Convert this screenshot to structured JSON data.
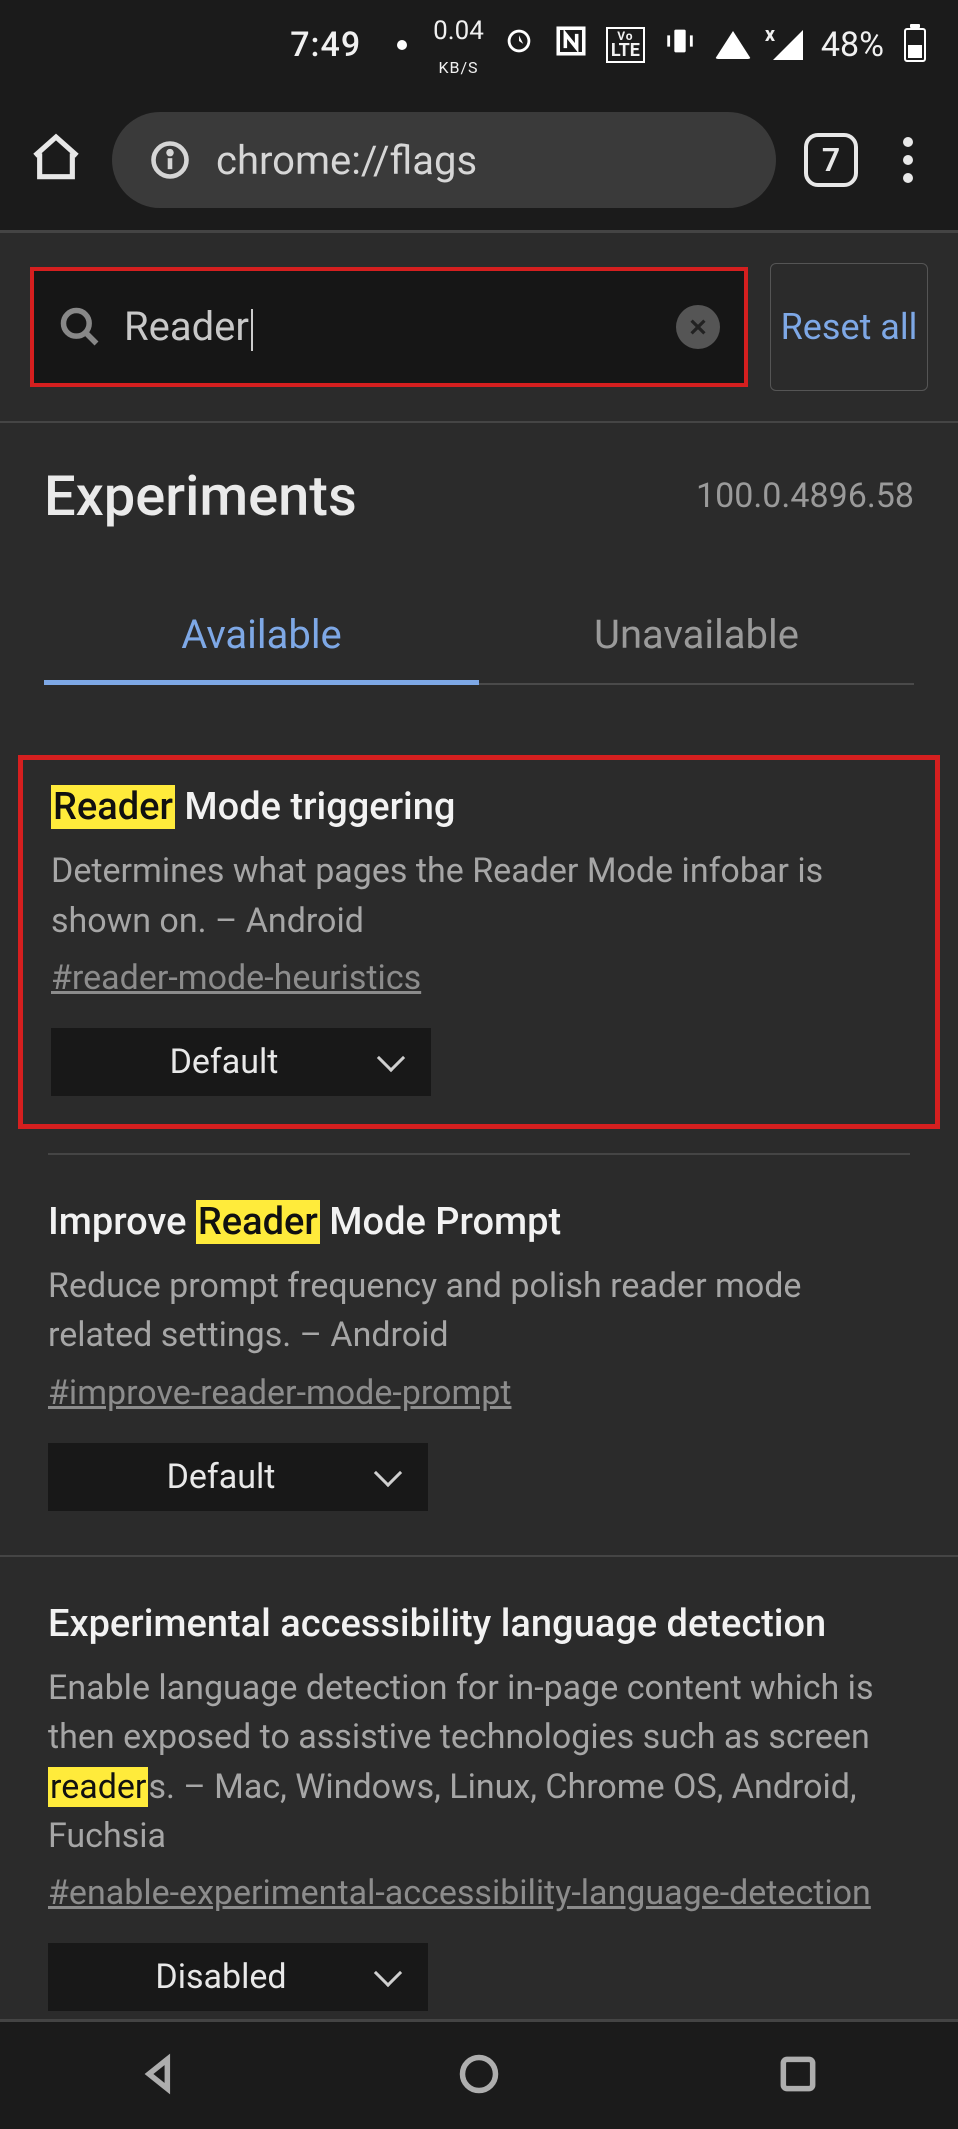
{
  "status": {
    "time": "7:49",
    "kbs_value": "0.04",
    "kbs_label": "KB/S",
    "lte_vo": "Vo",
    "lte_text": "LTE",
    "signal_x": "x",
    "battery_pct": "48%"
  },
  "browser": {
    "url": "chrome://flags",
    "tab_count": "7"
  },
  "flags": {
    "search_value": "Reader",
    "reset_label": "Reset all",
    "page_title": "Experiments",
    "version": "100.0.4896.58",
    "tabs": {
      "available": "Available",
      "unavailable": "Unavailable"
    },
    "entries": [
      {
        "title_before_hl": "",
        "title_hl": "Reader",
        "title_after_hl": " Mode triggering",
        "desc_before_hl": "Determines what pages the Reader Mode infobar is shown on. – Android",
        "desc_hl": "",
        "desc_after_hl": "",
        "anchor": "#reader-mode-heuristics",
        "dropdown_value": "Default"
      },
      {
        "title_before_hl": "Improve ",
        "title_hl": "Reader",
        "title_after_hl": " Mode Prompt",
        "desc_before_hl": "Reduce prompt frequency and polish reader mode related settings. – Android",
        "desc_hl": "",
        "desc_after_hl": "",
        "anchor": "#improve-reader-mode-prompt",
        "dropdown_value": "Default"
      },
      {
        "title_before_hl": "Experimental accessibility language detection",
        "title_hl": "",
        "title_after_hl": "",
        "desc_before_hl": "Enable language detection for in-page content which is then exposed to assistive technologies such as screen ",
        "desc_hl": "reader",
        "desc_after_hl": "s. – Mac, Windows, Linux, Chrome OS, Android, Fuchsia",
        "anchor": "#enable-experimental-accessibility-language-detection",
        "dropdown_value": "Disabled"
      }
    ]
  }
}
